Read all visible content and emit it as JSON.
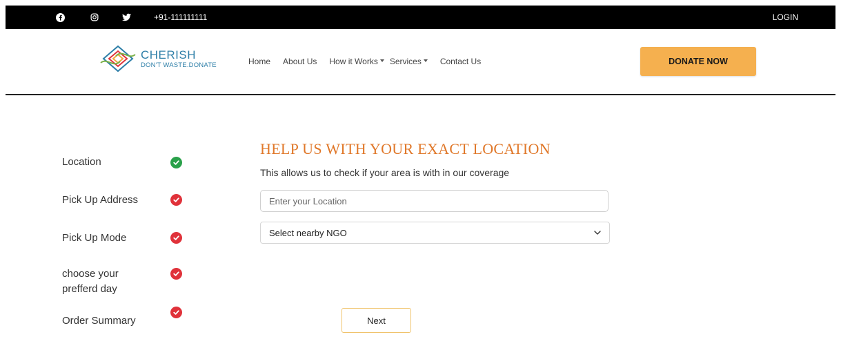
{
  "topbar": {
    "icons": [
      "facebook-icon",
      "instagram-icon",
      "twitter-icon"
    ],
    "phone": "+91-111111111",
    "login": "LOGIN"
  },
  "brand": {
    "name": "CHERISH",
    "tagline": "DON'T WASTE.DONATE",
    "color": "#2e7fa8"
  },
  "nav": {
    "home": "Home",
    "about": "About Us",
    "how": "How it Works",
    "services": "Services",
    "contact": "Contact Us"
  },
  "donate": {
    "label": "DONATE NOW",
    "color": "#f5b04f"
  },
  "steps": [
    {
      "label": "Location",
      "status": "complete",
      "color": "#2aa14a"
    },
    {
      "label": "Pick Up Address",
      "status": "pending",
      "color": "#e0323a"
    },
    {
      "label": "Pick Up Mode",
      "status": "pending",
      "color": "#e0323a"
    },
    {
      "label": "choose your prefferd day",
      "status": "pending",
      "color": "#e0323a"
    },
    {
      "label": "Order Summary",
      "status": "pending",
      "color": "#e0323a"
    }
  ],
  "form": {
    "title": "HELP US WITH YOUR EXACT LOCATION",
    "subtitle": "This allows us to check if your area is with in our coverage",
    "location_placeholder": "Enter your Location",
    "location_value": "",
    "ngo_select": "Select nearby NGO",
    "next": "Next",
    "accent": "#e0782a"
  }
}
